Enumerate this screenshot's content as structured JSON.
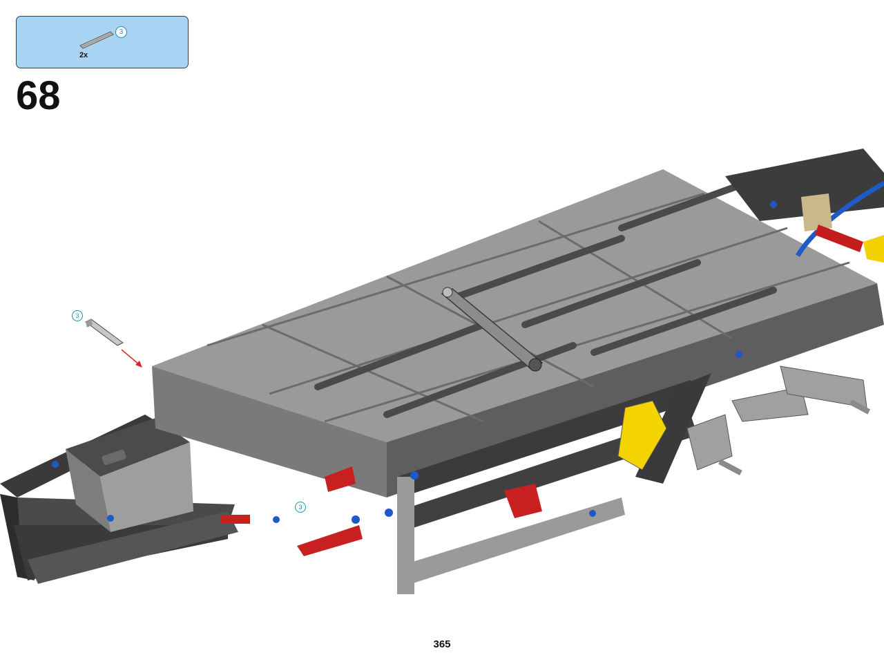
{
  "parts": {
    "quantity": "2x",
    "callout": "3"
  },
  "step": {
    "number": "68"
  },
  "callouts": {
    "free_axle": "3",
    "inserted_axle": "3"
  },
  "page": {
    "number": "365"
  },
  "colors": {
    "parts_box_bg": "#a9d3f2",
    "callout_text": "#1c8fb8",
    "arrow": "#d9232a"
  }
}
